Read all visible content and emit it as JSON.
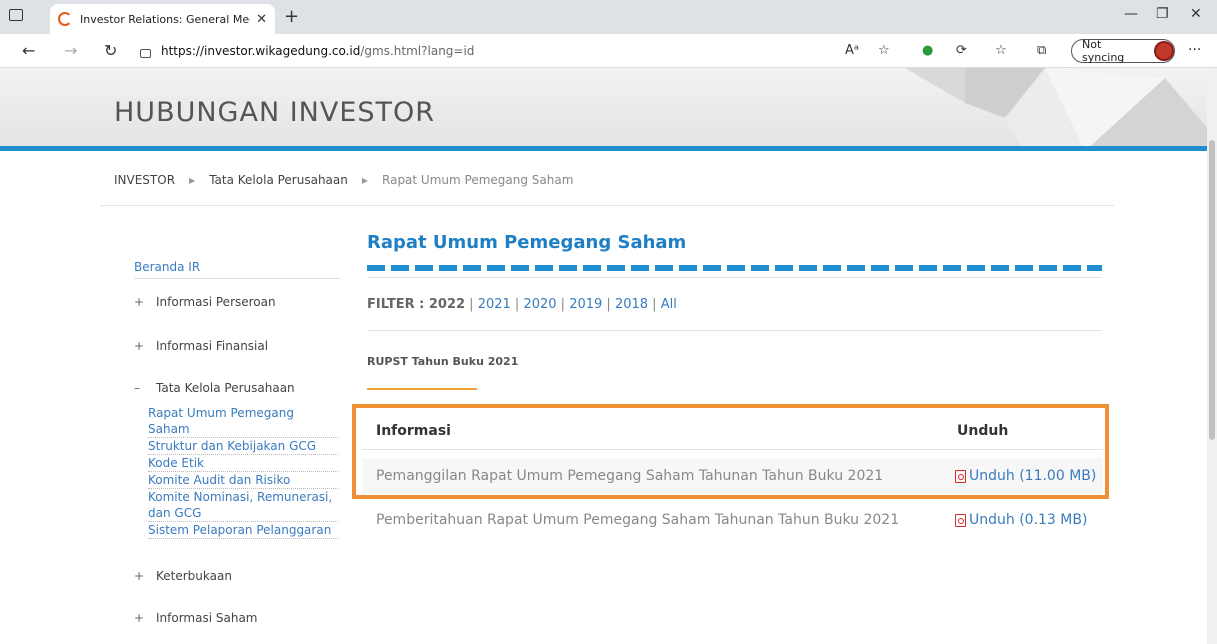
{
  "browser": {
    "tab_title": "Investor Relations: General Meet",
    "url_host": "https://investor.wikagedung.co.id",
    "url_path": "/gms.html?lang=id",
    "sync_label": "Not syncing"
  },
  "header": {
    "title": "HUBUNGAN INVESTOR"
  },
  "breadcrumb": [
    "INVESTOR",
    "Tata Kelola Perusahaan",
    "Rapat Umum Pemegang Saham"
  ],
  "sidebar": {
    "home": "Beranda IR",
    "sections": [
      {
        "toggle": "+",
        "label": "Informasi Perseroan"
      },
      {
        "toggle": "+",
        "label": "Informasi Finansial"
      },
      {
        "toggle": "–",
        "label": "Tata Kelola Perusahaan"
      },
      {
        "toggle": "+",
        "label": "Keterbukaan"
      },
      {
        "toggle": "+",
        "label": "Informasi Saham"
      }
    ],
    "sub_items": [
      "Rapat Umum Pemegang Saham",
      "Struktur dan Kebijakan GCG",
      "Kode Etik",
      "Komite Audit dan Risiko",
      "Komite Nominasi, Remunerasi,",
      "dan GCG",
      "Sistem Pelaporan Pelanggaran"
    ]
  },
  "main": {
    "title": "Rapat Umum Pemegang Saham",
    "filter_label": "FILTER : 2022",
    "filter_years": [
      "2021",
      "2020",
      "2019",
      "2018",
      "All"
    ],
    "section_title": "RUPST Tahun Buku 2021",
    "table_headers": [
      "Informasi",
      "Unduh"
    ],
    "rows": [
      {
        "info": "Pemanggilan Rapat Umum Pemegang Saham Tahunan Tahun Buku 2021",
        "download": "Unduh (11.00 MB)"
      },
      {
        "info": "Pemberitahuan Rapat Umum Pemegang Saham Tahunan Tahun Buku 2021",
        "download": "Unduh (0.13 MB)"
      }
    ]
  },
  "colors": {
    "accent": "#1f8fd1",
    "highlight": "#f08f33",
    "link": "#3a7bbf"
  }
}
